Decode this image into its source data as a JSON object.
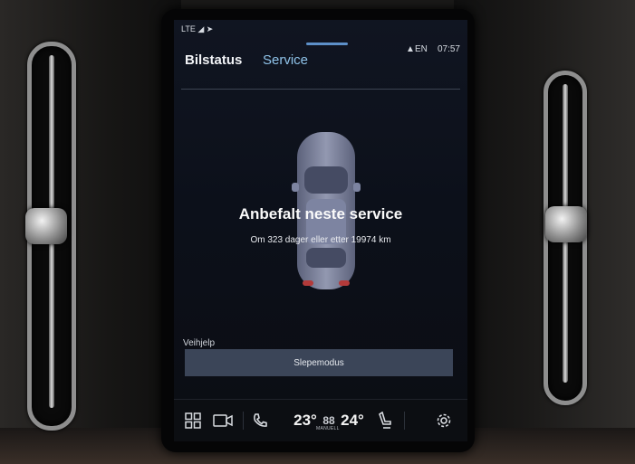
{
  "status_bar": {
    "network": "LTE",
    "language": "EN",
    "time": "07:57"
  },
  "tabs": [
    {
      "label": "Bilstatus",
      "active": true
    },
    {
      "label": "Service",
      "active": false
    }
  ],
  "service": {
    "title": "Anbefalt neste service",
    "detail": "Om 323 dager eller etter 19974 km"
  },
  "roadside": {
    "label": "Veihjelp",
    "tow_mode_button": "Slepemodus"
  },
  "climate_bar": {
    "temp_left": "23°",
    "fan_level": "88",
    "mode": "MANUELL",
    "temp_right": "24°"
  },
  "icons": {
    "home": "grid-icon",
    "camera": "camera-icon",
    "phone": "phone-icon",
    "seat": "seat-heat-icon",
    "settings": "gear-icon"
  },
  "colors": {
    "accent": "#8fc3e9",
    "handle": "#5d90c9",
    "button_bg": "#3b4558"
  }
}
